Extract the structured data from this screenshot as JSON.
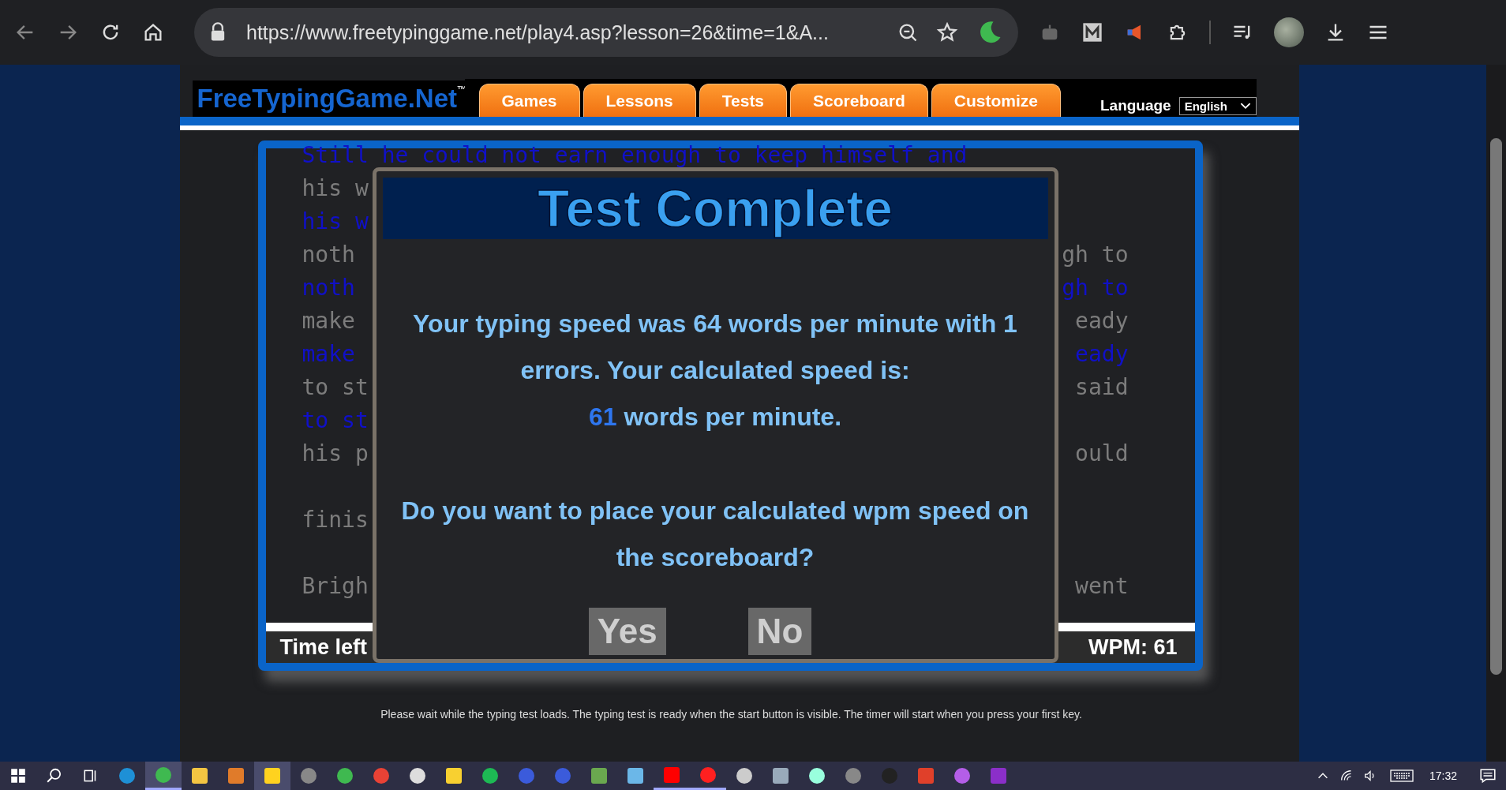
{
  "browser": {
    "url": "https://www.freetypinggame.net/play4.asp?lesson=26&time=1&A..."
  },
  "site": {
    "logo": "FreeTypingGame.Net",
    "logo_mark": "™",
    "nav_tabs": [
      {
        "label": "Games"
      },
      {
        "label": "Lessons"
      },
      {
        "label": "Tests"
      },
      {
        "label": "Scoreboard"
      },
      {
        "label": "Customize"
      }
    ],
    "language_label": "Language",
    "language_value": "English"
  },
  "typing_area": {
    "lines": [
      {
        "kind": "typed",
        "left": "Still he could not earn enough to keep himself and"
      },
      {
        "kind": "source",
        "left": "his w"
      },
      {
        "kind": "typed",
        "left": "his w"
      },
      {
        "kind": "source",
        "left": "noth",
        "right": "gh to"
      },
      {
        "kind": "typed",
        "left": "noth",
        "right": "gh to"
      },
      {
        "kind": "source",
        "left": "make",
        "right": "eady"
      },
      {
        "kind": "typed",
        "left": "make",
        "right": "eady"
      },
      {
        "kind": "source",
        "left": "to st",
        "right": "said"
      },
      {
        "kind": "typed",
        "left": "to st"
      },
      {
        "kind": "source",
        "left": "his p",
        "right": "ould"
      },
      {
        "kind": "blank"
      },
      {
        "kind": "source",
        "left": "finis"
      },
      {
        "kind": "blank"
      },
      {
        "kind": "source",
        "left": "Brigh",
        "right": "went"
      }
    ],
    "time_left_label": "Time left",
    "wpm": "WPM: 61"
  },
  "dialog": {
    "title": "Test Complete",
    "result": "Your typing speed was 64 words per minute with 1 errors. Your calculated speed is:",
    "calculated_value": "61",
    "calculated_unit": "words per minute.",
    "question": "Do you want to place your calculated wpm speed on the scoreboard?",
    "buttons": [
      "Yes",
      "No"
    ]
  },
  "footer_note": "Please wait while the typing test loads. The typing test is ready when the start button is visible. The timer will start when you press your first key.",
  "taskbar": {
    "apps": [
      {
        "kind": "edge",
        "running": false,
        "selected": false
      },
      {
        "kind": "green",
        "running": true,
        "selected": true
      },
      {
        "kind": "folder",
        "running": false,
        "selected": false
      },
      {
        "kind": "orange",
        "running": false,
        "selected": false
      },
      {
        "kind": "note",
        "running": false,
        "selected": true
      },
      {
        "kind": "grey",
        "running": false,
        "selected": false
      },
      {
        "kind": "green",
        "running": false,
        "selected": false
      },
      {
        "kind": "chrome",
        "running": false,
        "selected": false
      },
      {
        "kind": "play",
        "running": false,
        "selected": false
      },
      {
        "kind": "yellow",
        "running": false,
        "selected": false
      },
      {
        "kind": "spotify",
        "running": false,
        "selected": false
      },
      {
        "kind": "headphones",
        "running": false,
        "selected": false
      },
      {
        "kind": "headphones",
        "running": false,
        "selected": false
      },
      {
        "kind": "sheet",
        "running": false,
        "selected": false
      },
      {
        "kind": "bird",
        "running": false,
        "selected": false
      },
      {
        "kind": "youtube",
        "running": true,
        "selected": false
      },
      {
        "kind": "ytmusic",
        "running": true,
        "selected": false
      },
      {
        "kind": "clock",
        "running": false,
        "selected": false
      },
      {
        "kind": "signal",
        "running": false,
        "selected": false
      },
      {
        "kind": "cloud",
        "running": false,
        "selected": false
      },
      {
        "kind": "grey",
        "running": false,
        "selected": false
      },
      {
        "kind": "dark",
        "running": false,
        "selected": false
      },
      {
        "kind": "red",
        "running": false,
        "selected": false
      },
      {
        "kind": "podcast",
        "running": false,
        "selected": false
      },
      {
        "kind": "onenote",
        "running": false,
        "selected": false
      }
    ],
    "clock": "17:32"
  }
}
